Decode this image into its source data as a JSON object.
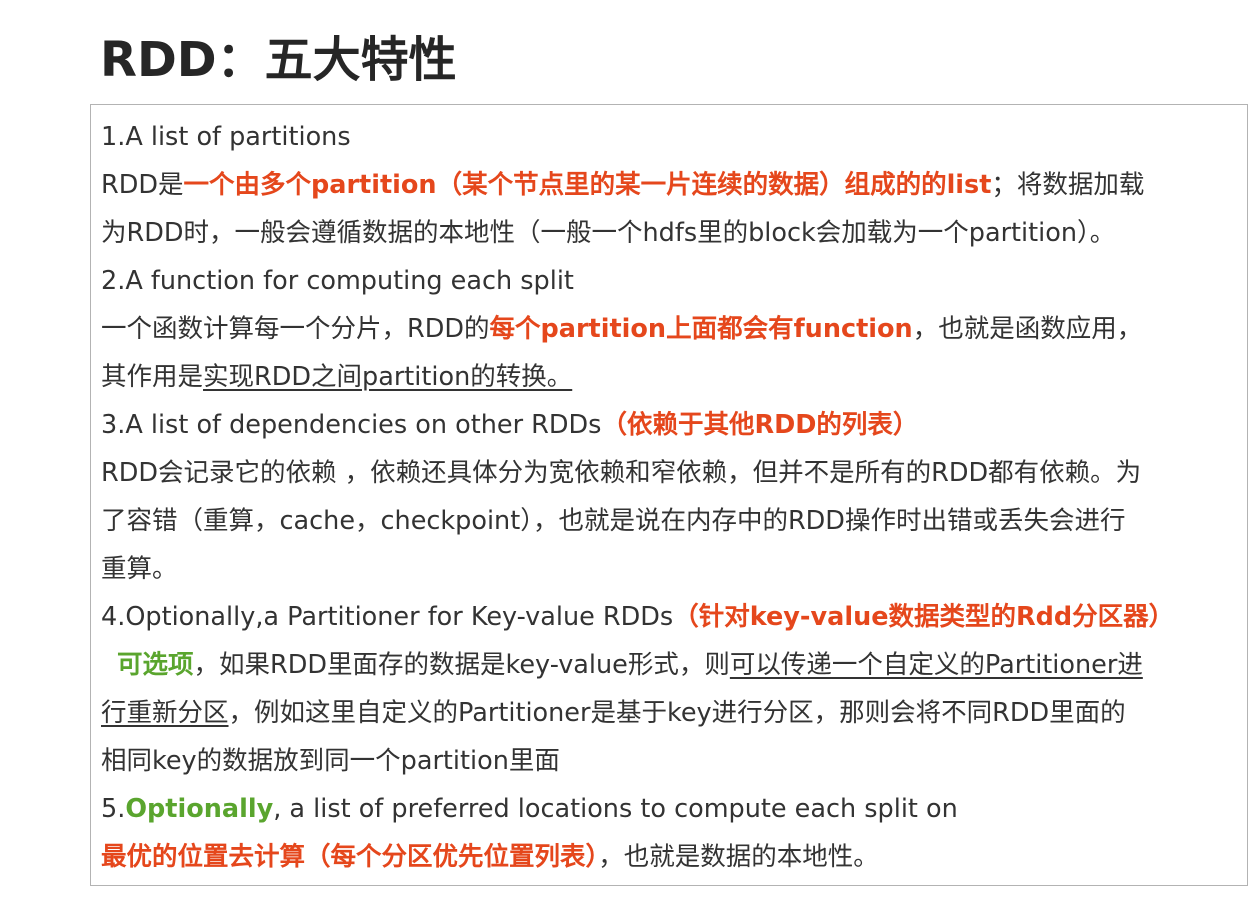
{
  "title": "RDD：五大特性",
  "items": [
    {
      "heading": "1.A list of partitions",
      "line1": {
        "a": "RDD是",
        "b": "一个由多个partition（某个节点里的某一片连续的数据）组成的的list",
        "c": "；将数据加载"
      },
      "line2": "为RDD时，一般会遵循数据的本地性（一般一个hdfs里的block会加载为一个partition）。"
    },
    {
      "heading": "2.A function for computing each split",
      "line1": {
        "a": "一个函数计算每一个分片，RDD的",
        "b": "每个partition上面都会有function",
        "c": "，也就是函数应用，"
      },
      "line2": {
        "a": "其作用是",
        "b": "实现RDD之间partition的转换。"
      }
    },
    {
      "heading": {
        "a": "3.A list of dependencies on other RDDs",
        "b": "（依赖于其他RDD的列表）"
      },
      "lines": [
        "RDD会记录它的依赖 ，依赖还具体分为宽依赖和窄依赖，但并不是所有的RDD都有依赖。为",
        "了容错（重算，cache，checkpoint），也就是说在内存中的RDD操作时出错或丢失会进行",
        "重算。"
      ]
    },
    {
      "heading": {
        "a": "4.Optionally,a Partitioner for Key-value RDDs",
        "b": "（针对key-value数据类型的Rdd分区器）"
      },
      "line1": {
        "a": "可选项",
        "b": "，如果RDD里面存的数据是key-value形式，则",
        "c": "可以传递一个自定义的Partitioner进"
      },
      "line2": {
        "a": "行重新分区",
        "b": "，例如这里自定义的Partitioner是基于key进行分区，那则会将不同RDD里面的"
      },
      "line3": "相同key的数据放到同一个partition里面"
    },
    {
      "heading": {
        "a": "5.",
        "b": "Optionally",
        "c": ", a list of preferred locations to compute each split on"
      },
      "line1": {
        "a": "最优的位置去计算（每个分区优先位置列表）",
        "b": "，也就是数据的本地性。"
      }
    }
  ],
  "colors": {
    "accent_red": "#e5471c",
    "accent_green": "#5aa52e",
    "text": "#333333",
    "border": "#b3b3b3"
  }
}
